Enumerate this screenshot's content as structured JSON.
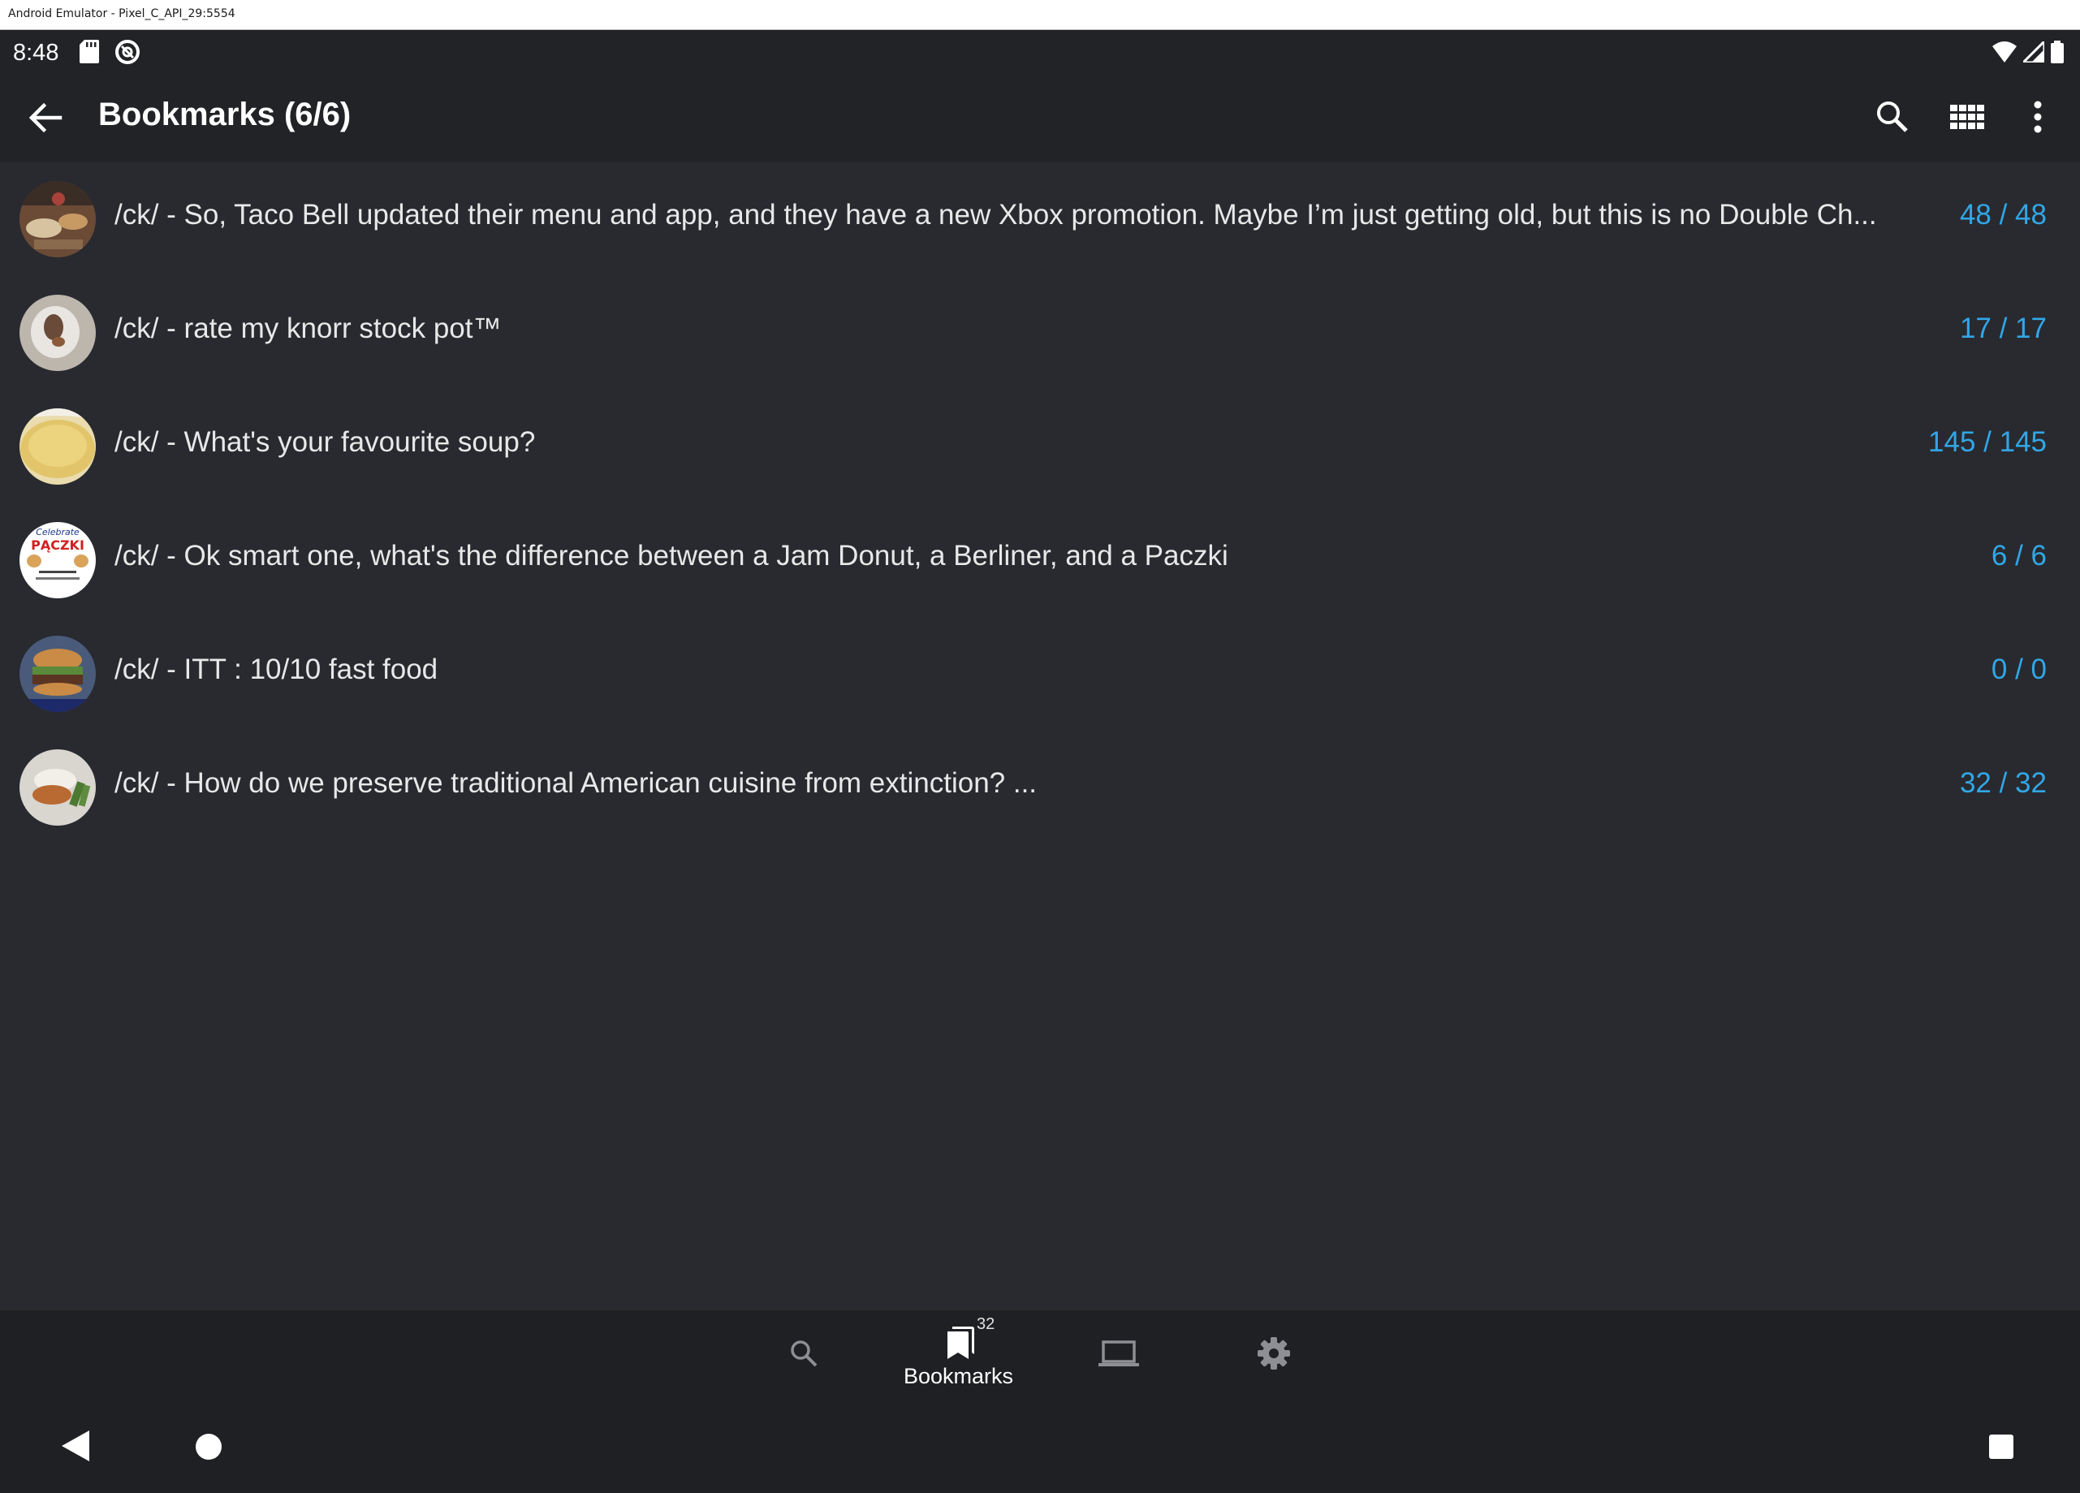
{
  "window": {
    "title": "Android Emulator - Pixel_C_API_29:5554"
  },
  "status_bar": {
    "time": "8:48",
    "icons": [
      "sd-card-icon",
      "sync-icon",
      "wifi-icon",
      "signal-icon",
      "battery-icon"
    ]
  },
  "toolbar": {
    "title": "Bookmarks (6/6)",
    "actions": [
      "back-arrow-icon",
      "search-icon",
      "grid-view-icon",
      "more-vert-icon"
    ]
  },
  "bookmarks": [
    {
      "title": "/ck/ - So, Taco Bell updated their menu and app, and they have a new Xbox promotion. Maybe I’m just getting old, but this is no Double Ch...",
      "count": "48 / 48"
    },
    {
      "title": "/ck/ - rate my knorr stock pot™",
      "count": "17 / 17"
    },
    {
      "title": "/ck/ - What's your favourite soup?",
      "count": "145 / 145"
    },
    {
      "title": "/ck/ - Ok smart one, what's the difference between a Jam Donut, a Berliner, and a Paczki",
      "count": "6 / 6"
    },
    {
      "title": "/ck/ - ITT : 10/10 fast food",
      "count": "0 / 0"
    },
    {
      "title": "/ck/ - How do we preserve traditional American cuisine from extinction? ...",
      "count": "32 / 32"
    }
  ],
  "thumb_text": {
    "paczki": "PĄCZKI",
    "celebrate": "Celebrate"
  },
  "bottom_nav": {
    "search_icon": "search-icon",
    "bookmarks_label": "Bookmarks",
    "bookmarks_badge": "32",
    "browse_icon": "laptop-icon",
    "settings_icon": "gear-icon"
  },
  "system_nav": [
    "back-triangle-icon",
    "home-circle-icon",
    "recents-square-icon"
  ],
  "colors": {
    "background": "#282a30",
    "toolbar": "#222327",
    "accent": "#31a7e6",
    "bottom_bar": "#1f2023"
  }
}
